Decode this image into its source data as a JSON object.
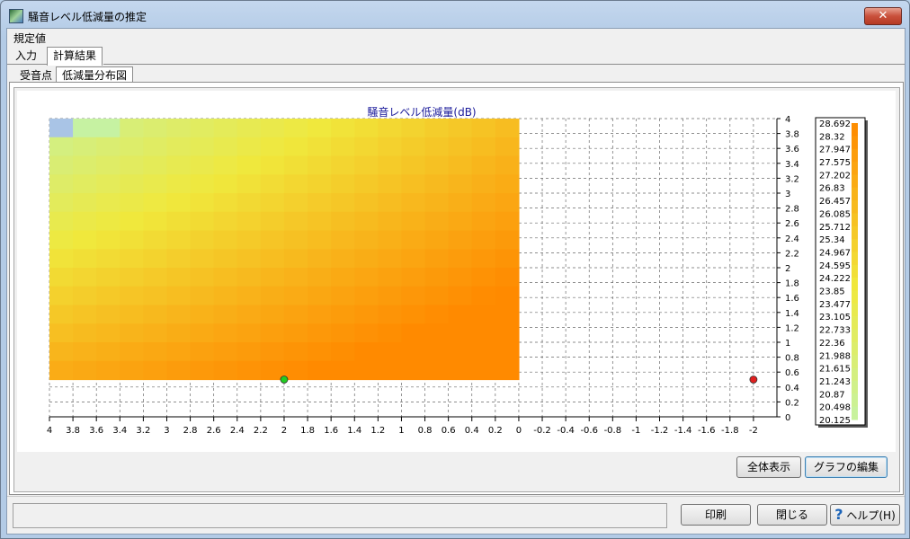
{
  "window": {
    "title": "騒音レベル低減量の推定",
    "close_label": "✕"
  },
  "menu": {
    "items": [
      {
        "label": "規定値"
      }
    ]
  },
  "tabs_main": [
    {
      "label": "入力"
    },
    {
      "label": "計算結果"
    }
  ],
  "tabs_sub": [
    {
      "label": "受音点"
    },
    {
      "label": "低減量分布図"
    }
  ],
  "buttons": {
    "fit_all": "全体表示",
    "edit_graph": "グラフの編集",
    "print": "印刷",
    "close": "閉じる",
    "help": "ヘルプ(H)"
  },
  "colors": {
    "title_text": "#1a1a9a",
    "color_low": "#c6f2a2",
    "color_mid": "#f0e83c",
    "color_high": "#ff8a00",
    "marker_green": "#22cc22",
    "marker_red": "#e02020"
  },
  "chart_data": {
    "type": "heatmap",
    "title": "騒音レベル低減量(dB)",
    "xlim": [
      4,
      -2.2
    ],
    "ylim": [
      0,
      4
    ],
    "x_ticks": [
      "4",
      "3.8",
      "3.6",
      "3.4",
      "3.2",
      "3",
      "2.8",
      "2.6",
      "2.4",
      "2.2",
      "2",
      "1.8",
      "1.6",
      "1.4",
      "1.2",
      "1",
      "0.8",
      "0.6",
      "0.4",
      "0.2",
      "0",
      "-0.2",
      "-0.4",
      "-0.6",
      "-0.8",
      "-1",
      "-1.2",
      "-1.4",
      "-1.6",
      "-1.8",
      "-2"
    ],
    "y_ticks": [
      "0",
      "0.2",
      "0.4",
      "0.6",
      "0.8",
      "1",
      "1.2",
      "1.4",
      "1.6",
      "1.8",
      "2",
      "2.2",
      "2.4",
      "2.6",
      "2.8",
      "3",
      "3.2",
      "3.4",
      "3.6",
      "3.8",
      "4"
    ],
    "grid": true,
    "legend": {
      "placement": "right",
      "labels": [
        "28.692",
        "28.32",
        "27.947",
        "27.575",
        "27.202",
        "26.83",
        "26.457",
        "26.085",
        "25.712",
        "25.34",
        "24.967",
        "24.595",
        "24.222",
        "23.85",
        "23.477",
        "23.105",
        "22.733",
        "22.36",
        "21.988",
        "21.615",
        "21.243",
        "20.87",
        "20.498",
        "20.125"
      ]
    },
    "region": {
      "x_from": 4,
      "x_to": 0,
      "y_from": 0.5,
      "y_to": 4,
      "cell_size": 0.2
    },
    "value_range": [
      20.125,
      28.692
    ],
    "markers": [
      {
        "name": "green",
        "x": 2,
        "y": 0.5
      },
      {
        "name": "red",
        "x": -2,
        "y": 0.5
      }
    ]
  }
}
